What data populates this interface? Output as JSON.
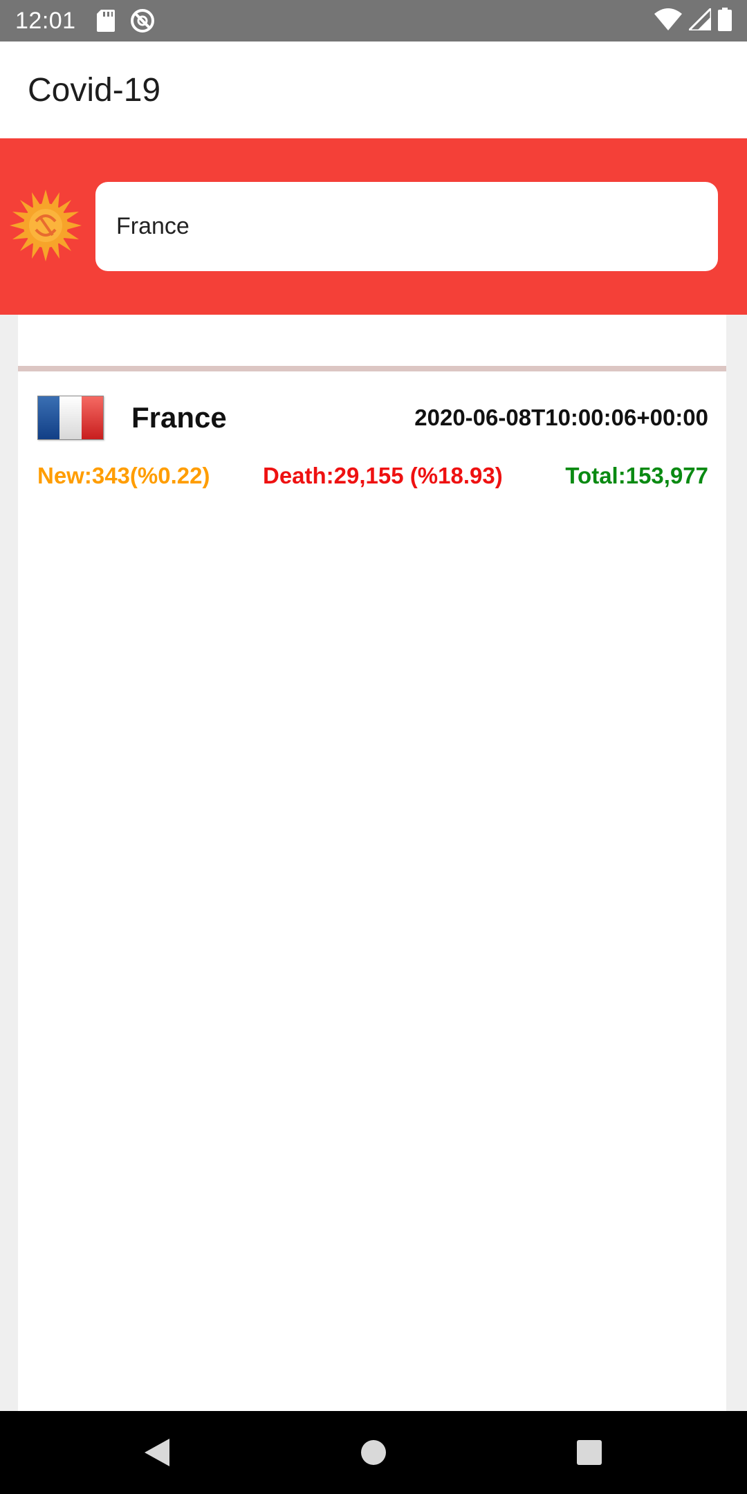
{
  "status_bar": {
    "time": "12:01",
    "icons": [
      "sd-card-icon",
      "sync-disabled-icon",
      "wifi-icon",
      "signal-icon",
      "battery-icon"
    ]
  },
  "app_bar": {
    "title": "Covid-19"
  },
  "search": {
    "value": "France",
    "logo_icon": "sun-logo-icon"
  },
  "country_card": {
    "flag_icon": "france-flag-icon",
    "name": "France",
    "updated": "2020-06-08T10:00:06+00:00",
    "new_cases": "New:343(%0.22)",
    "deaths": "Death:29,155 (%18.93)",
    "total": "Total:153,977"
  },
  "colors": {
    "header_red": "#f44038",
    "new_orange": "#ff9d00",
    "death_red": "#ee1111",
    "total_green": "#0a8a12"
  },
  "nav_bar": {
    "icons": [
      "back-icon",
      "home-icon",
      "recents-icon"
    ]
  }
}
